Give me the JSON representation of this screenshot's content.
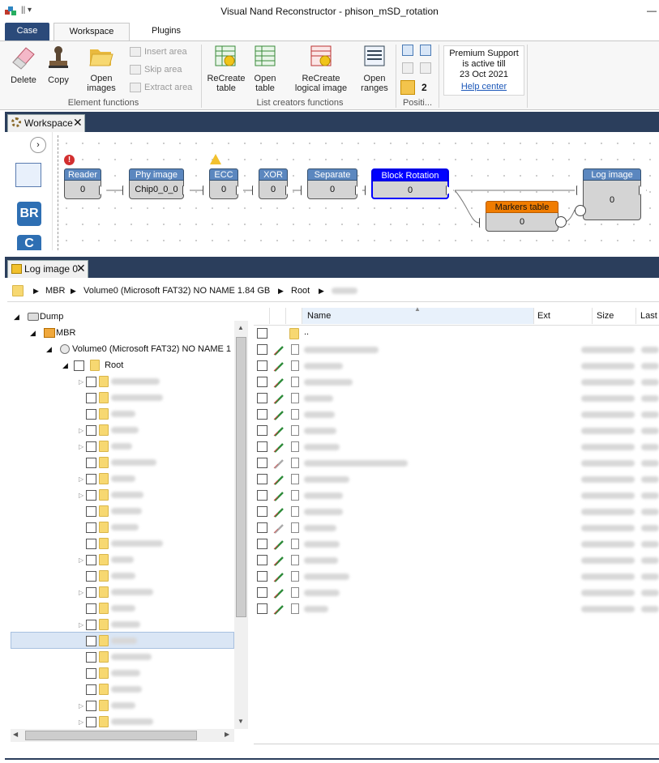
{
  "window": {
    "title": "Visual Nand Reconstructor - phison_mSD_rotation",
    "minimize_glyph": "—"
  },
  "ribbon_tabs": [
    {
      "label": "Case"
    },
    {
      "label": "Workspace"
    },
    {
      "label": "Plugins"
    }
  ],
  "ribbon": {
    "delete": "Delete",
    "copy": "Copy",
    "open_images": [
      "Open",
      "images"
    ],
    "insert_area": "Insert area",
    "skip_area": "Skip area",
    "extract_area": "Extract area",
    "element_functions": "Element functions",
    "recreate_table": [
      "ReCreate",
      "table"
    ],
    "open_table": [
      "Open",
      "table"
    ],
    "recreate_logical": [
      "ReCreate",
      "logical image"
    ],
    "open_ranges": [
      "Open",
      "ranges"
    ],
    "list_creators": "List creators functions",
    "position_count": "2",
    "position_label": "Positi...",
    "support": {
      "line1": "Premium Support",
      "line2": "is active till",
      "line3": "23 Oct 2021",
      "link": "Help center"
    }
  },
  "workspace_tab": "Workspace",
  "nodes": {
    "reader": {
      "title": "Reader",
      "value": "0"
    },
    "phy": {
      "title": "Phy image",
      "value": "Chip0_0_0"
    },
    "ecc": {
      "title": "ECC",
      "value": "0"
    },
    "xor": {
      "title": "XOR",
      "value": "0"
    },
    "separate": {
      "title": "Separate",
      "value": "0"
    },
    "rotation": {
      "title": "Block Rotation",
      "value": "0"
    },
    "markers": {
      "title": "Markers table",
      "value": "0"
    },
    "log": {
      "title": "Log image",
      "value": "0"
    }
  },
  "side_icons": {
    "br": "BR",
    "c": "C"
  },
  "log_tab": "Log image 0",
  "breadcrumb": {
    "mbr": "MBR",
    "volume": "Volume0 (Microsoft FAT32) NO NAME  1.84 GB",
    "root": "Root"
  },
  "tree": {
    "dump": "Dump",
    "mbr": "MBR",
    "volume": "Volume0 (Microsoft FAT32) NO NAME  1",
    "root": "Root"
  },
  "list": {
    "columns": {
      "name": "Name",
      "ext": "Ext",
      "size": "Size",
      "last": "Last"
    },
    "parent": ".."
  },
  "colors": {
    "accent": "#2b3e5c",
    "node_header": "#5b87bf",
    "selected_node": "#0000ff",
    "markers": "#f07c00"
  }
}
